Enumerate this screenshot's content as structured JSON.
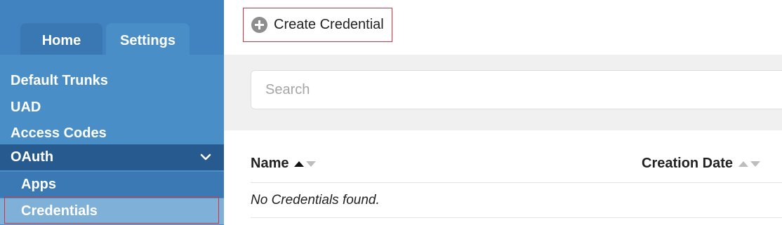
{
  "sidebar": {
    "tabs": [
      {
        "label": "Home"
      },
      {
        "label": "Settings"
      }
    ],
    "items": [
      {
        "label": "Default Trunks"
      },
      {
        "label": "UAD"
      },
      {
        "label": "Access Codes"
      },
      {
        "label": "OAuth",
        "expanded": true
      },
      {
        "label": "Apps"
      },
      {
        "label": "Credentials",
        "selected": true
      }
    ]
  },
  "main": {
    "create_button_label": "Create Credential",
    "search_placeholder": "Search",
    "table": {
      "columns": [
        {
          "label": "Name",
          "sort": "ascending"
        },
        {
          "label": "Creation Date",
          "sort": "none"
        }
      ],
      "empty_message": "No Credentials found."
    }
  },
  "icons": {
    "create": "plus-circle-icon",
    "expand": "chevron-down-icon"
  },
  "colors": {
    "sidebar_bg": "#4a8ec8",
    "sidebar_active_group": "#275a8f",
    "sidebar_selected": "#7fb0d8",
    "highlight_outline": "#d0343e",
    "search_band": "#f0f0f0"
  }
}
